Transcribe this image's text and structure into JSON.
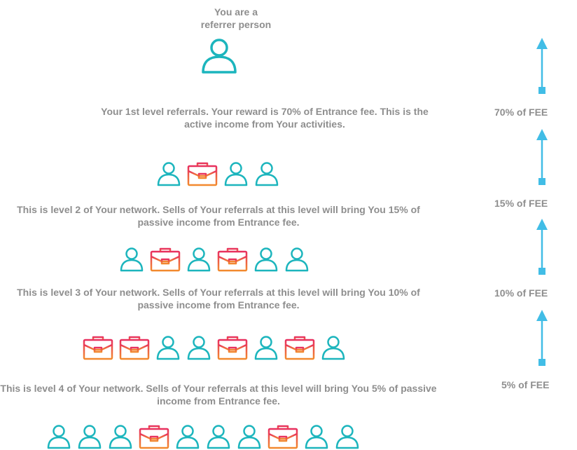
{
  "top": {
    "line1": "You are a",
    "line2": "referrer person"
  },
  "levels": [
    {
      "text": "Your 1st level referrals. Your reward is 70% of Entrance fee. This is the active income from Your activities.",
      "icons": [
        "person-icon",
        "briefcase-icon",
        "person-icon",
        "person-icon"
      ]
    },
    {
      "text": "This is level 2 of Your network. Sells of Your referrals at this level will bring You 15% of passive income from Entrance fee.",
      "icons": [
        "person-icon",
        "briefcase-icon",
        "person-icon",
        "briefcase-icon",
        "person-icon",
        "person-icon"
      ]
    },
    {
      "text": "This is level 3 of Your network. Sells of Your referrals at this level will bring You 10% of passive income from Entrance fee.",
      "icons": [
        "briefcase-icon",
        "briefcase-icon",
        "person-icon",
        "person-icon",
        "briefcase-icon",
        "person-icon",
        "briefcase-icon",
        "person-icon"
      ]
    },
    {
      "text": "This is level 4 of Your network. Sells of Your referrals at this level will bring You 5% of passive income from Entrance fee.",
      "icons": [
        "person-icon",
        "person-icon",
        "person-icon",
        "briefcase-icon",
        "person-icon",
        "person-icon",
        "person-icon",
        "briefcase-icon",
        "person-icon",
        "person-icon"
      ]
    }
  ],
  "fees": [
    "70% of FEE",
    "15% of FEE",
    "10% of FEE",
    "5% of FEE"
  ],
  "colors": {
    "text": "#8e8e8e",
    "person": "#1cb5bd",
    "briefcase_top": "#e8305f",
    "briefcase_bottom": "#f28a2e",
    "arrow": "#41bde6"
  }
}
